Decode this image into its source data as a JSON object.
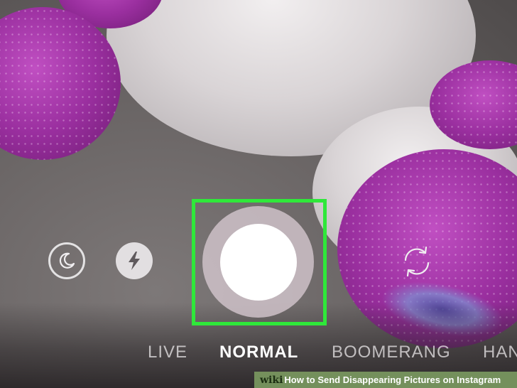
{
  "camera": {
    "modes": [
      "LIVE",
      "NORMAL",
      "BOOMERANG",
      "HAN"
    ],
    "active_mode": "NORMAL",
    "icons": {
      "night": "moon-icon",
      "flash": "flash-icon",
      "flip": "flip-camera-icon"
    },
    "highlight_color": "#2fe83a"
  },
  "footer": {
    "logo": "wiki",
    "caption": "How to Send Disappearing Pictures on Instagram"
  }
}
